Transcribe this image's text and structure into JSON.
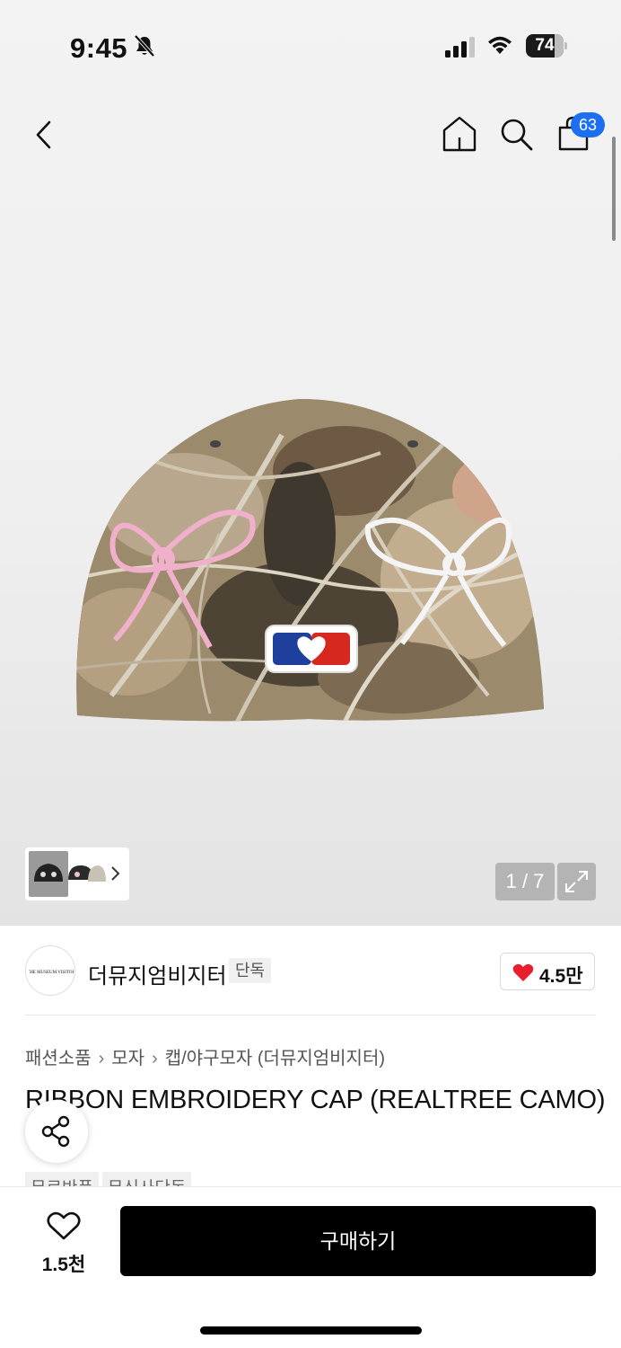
{
  "status_bar": {
    "time": "9:45",
    "battery": "74",
    "icons": [
      "bell-slash-icon",
      "signal-icon",
      "wifi-icon",
      "battery-icon"
    ]
  },
  "nav": {
    "icons": [
      "chevron-left-icon",
      "home-icon",
      "search-icon",
      "shopping-bag-icon"
    ],
    "cart_count": "63"
  },
  "gallery": {
    "counter": "1 / 7",
    "current_index": 1,
    "total": 7
  },
  "brand": {
    "name": "더뮤지엄비지터",
    "badge": "단독",
    "logo_text": "THE MUSEUM VISITOR",
    "likes": "4.5만"
  },
  "breadcrumb": [
    "패션소품",
    "모자",
    "캡/야구모자 (더뮤지엄비지터)"
  ],
  "product": {
    "title": "RIBBON EMBROIDERY CAP (REALTREE CAMO)",
    "tags": [
      "무료반품",
      "무신사단독"
    ]
  },
  "bottom_bar": {
    "wish_count": "1.5천",
    "buy_label": "구매하기"
  },
  "colors": {
    "accent_badge": "#1d6ff2",
    "like_heart": "#e8202b",
    "buy_button": "#000000"
  }
}
